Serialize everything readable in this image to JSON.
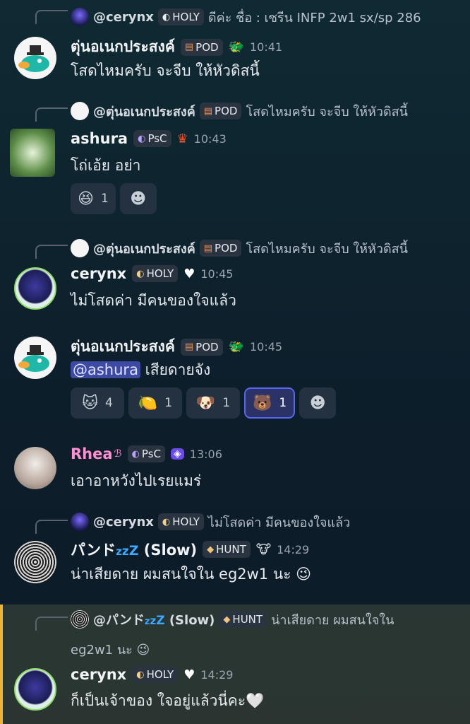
{
  "messages": [
    {
      "reply": {
        "user": "@cerynx",
        "tag": "HOLY",
        "text": "ดีค่ะ ชื่อ : เซรีน INFP 2w1 sx/sp 286"
      },
      "author": "ตุ่นอเนกประสงค์",
      "tag": "POD",
      "time": "10:41",
      "text": "โสดไหมครับ จะจีบ ให้หัวดิสนี้"
    },
    {
      "reply": {
        "user": "@ตุ่นอเนกประสงค์",
        "tag": "POD",
        "text": "โสดไหมครับ จะจีบ ให้หัวดิสนี้"
      },
      "author": "ashura",
      "tag": "PsC",
      "time": "10:43",
      "text": "โถ่เอ้ย อย่า",
      "reactions": [
        {
          "emoji": "😆",
          "count": "1"
        }
      ]
    },
    {
      "reply": {
        "user": "@ตุ่นอเนกประสงค์",
        "tag": "POD",
        "text": "โสดไหมครับ จะจีบ ให้หัวดิสนี้"
      },
      "author": "cerynx",
      "tag": "HOLY",
      "time": "10:45",
      "text": "ไม่โสดค่า มีคนของใจแล้ว"
    },
    {
      "author": "ตุ่นอเนกประสงค์",
      "tag": "POD",
      "time": "10:45",
      "mention": "@ashura",
      "text": "เสียดายจัง",
      "reactions": [
        {
          "emoji": "🐱",
          "count": "4"
        },
        {
          "emoji": "🍋",
          "count": "1"
        },
        {
          "emoji": "🐶",
          "count": "1"
        },
        {
          "emoji": "🐻",
          "count": "1"
        }
      ]
    },
    {
      "author": "Rhea",
      "tag": "PsC",
      "time": "13:06",
      "text": "เอาอาหวังไปเรยแมร่"
    },
    {
      "reply": {
        "user": "@cerynx",
        "tag": "HOLY",
        "text": "ไม่โสดค่า มีคนของใจแล้ว"
      },
      "author": "パンド",
      "suffix": "(Slow)",
      "tag": "HUNT",
      "time": "14:29",
      "text": "น่าเสียดาย ผมสนใจใน eg2w1 นะ 😉"
    },
    {
      "reply": {
        "user": "@パンド",
        "suffix": "(Slow)",
        "tag": "HUNT",
        "text": "น่าเสียดาย ผมสนใจใน",
        "text2": "eg2w1 นะ 😉"
      },
      "author": "cerynx",
      "tag": "HOLY",
      "time": "14:29",
      "text": "ก็เป็นเจ้าของ ใจอยู่แล้วนี่คะ🤍"
    }
  ],
  "colors": {
    "accent": "#5865f2",
    "highlight_bar": "#f0b232",
    "rhea_name": "#ff8fd2"
  }
}
